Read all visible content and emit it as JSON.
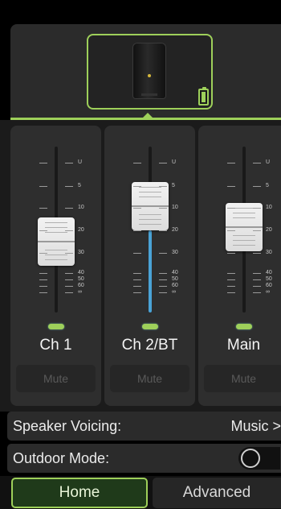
{
  "device": {
    "icon": "speaker-icon",
    "battery_icon": "battery-icon",
    "accent_color": "#9ed05a"
  },
  "scale_labels": [
    "U",
    "5",
    "10",
    "20",
    "30",
    "40",
    "50",
    "60",
    "∞"
  ],
  "channels": [
    {
      "name": "Ch 1",
      "mute_label": "Mute",
      "fader_level": 0.38
    },
    {
      "name": "Ch 2/BT",
      "mute_label": "Mute",
      "fader_level": 0.55
    },
    {
      "name": "Main",
      "mute_label": "Mute",
      "fader_level": 0.42
    }
  ],
  "settings": {
    "speaker_voicing_label": "Speaker Voicing:",
    "speaker_voicing_value": "Music >",
    "outdoor_mode_label": "Outdoor Mode:",
    "outdoor_mode_on": false
  },
  "tabs": [
    {
      "label": "Home",
      "active": true
    },
    {
      "label": "Advanced",
      "active": false
    }
  ]
}
